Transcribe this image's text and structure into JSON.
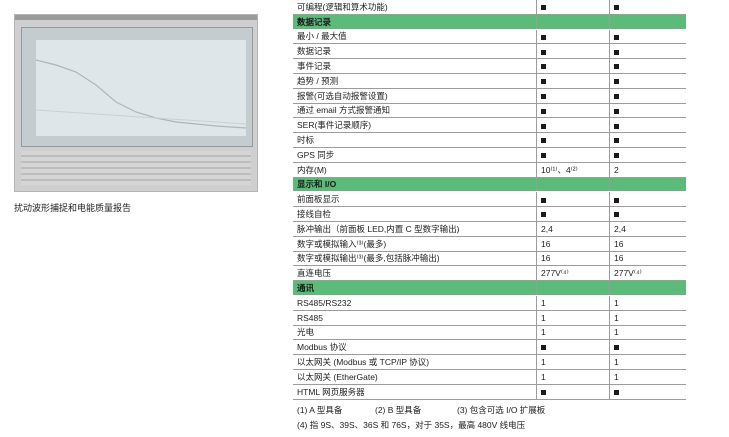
{
  "caption": "扰动波形捕捉和电能质量报告",
  "table": {
    "rows": [
      {
        "kind": "row",
        "label": "可编程(逻辑和算术功能)",
        "a": "■",
        "b": "■"
      },
      {
        "kind": "section",
        "label": "数据记录"
      },
      {
        "kind": "row",
        "label": "最小 / 最大值",
        "a": "■",
        "b": "■"
      },
      {
        "kind": "row",
        "label": "数据记录",
        "a": "■",
        "b": "■"
      },
      {
        "kind": "row",
        "label": "事件记录",
        "a": "■",
        "b": "■"
      },
      {
        "kind": "row",
        "label": "趋势 / 预测",
        "a": "■",
        "b": "■"
      },
      {
        "kind": "row",
        "label": "报警(可选自动报警设置)",
        "a": "■",
        "b": "■"
      },
      {
        "kind": "row",
        "label": "通过 email 方式报警通知",
        "a": "■",
        "b": "■"
      },
      {
        "kind": "row",
        "label": "SER(事件记录顺序)",
        "a": "■",
        "b": "■"
      },
      {
        "kind": "row",
        "label": "时标",
        "a": "■",
        "b": "■"
      },
      {
        "kind": "row",
        "label": "GPS 同步",
        "a": "■",
        "b": "■"
      },
      {
        "kind": "row",
        "label": "内存(M)",
        "a": "10⁽¹⁾、4⁽²⁾",
        "b": "2"
      },
      {
        "kind": "section",
        "label": "显示和 I/O"
      },
      {
        "kind": "row",
        "label": "前面板显示",
        "a": "■",
        "b": "■"
      },
      {
        "kind": "row",
        "label": "接线自检",
        "a": "■",
        "b": "■"
      },
      {
        "kind": "row",
        "label": "脉冲输出（前面板 LED,内置 C 型数字输出)",
        "a": "2,4",
        "b": "2,4"
      },
      {
        "kind": "row",
        "label": "数字或模拟输入⁽³⁾(最多)",
        "a": "16",
        "b": "16"
      },
      {
        "kind": "row",
        "label": "数字或模拟输出⁽³⁾(最多,包括脉冲输出)",
        "a": "16",
        "b": "16"
      },
      {
        "kind": "row",
        "label": "直连电压",
        "a": "277V⁽⁴⁾",
        "b": "277V⁽⁴⁾"
      },
      {
        "kind": "section",
        "label": "通讯"
      },
      {
        "kind": "row",
        "label": "RS485/RS232",
        "a": "1",
        "b": "1"
      },
      {
        "kind": "row",
        "label": "RS485",
        "a": "1",
        "b": "1"
      },
      {
        "kind": "row",
        "label": "光电",
        "a": "1",
        "b": "1"
      },
      {
        "kind": "row",
        "label": "Modbus 协议",
        "a": "■",
        "b": "■"
      },
      {
        "kind": "row",
        "label": "以太网关 (Modbus 或 TCP/IP 协议)",
        "a": "1",
        "b": "1"
      },
      {
        "kind": "row",
        "label": "以太网关 (EtherGate)",
        "a": "1",
        "b": "1"
      },
      {
        "kind": "row",
        "label": "HTML 网页服务器",
        "a": "■",
        "b": "■"
      }
    ]
  },
  "notes": {
    "n1": "(1) A 型具备",
    "n2": "(2) B 型具备",
    "n3": "(3) 包含可选 I/O 扩展板",
    "n4": "(4) 指 9S、39S、36S 和 76S，对于 35S，最高 480V 线电压"
  },
  "colors": {
    "section_bg": "#5dbb7a",
    "border": "#9c9c9c"
  }
}
